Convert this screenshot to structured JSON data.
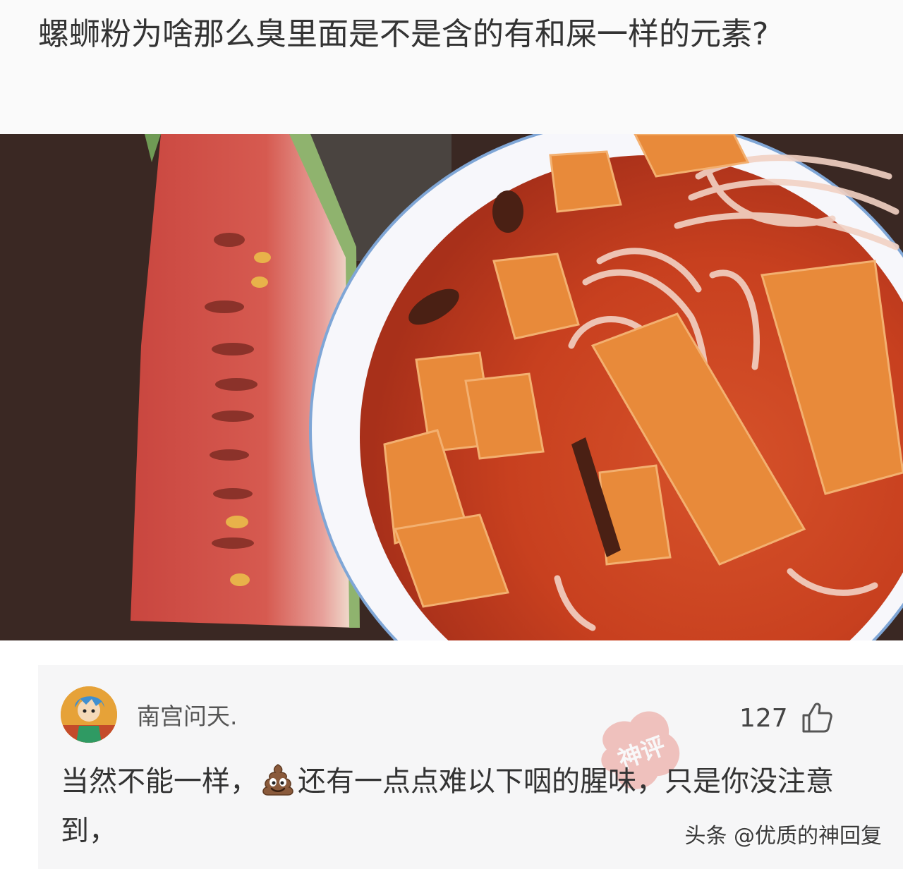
{
  "question": {
    "title": "螺蛳粉为啥那么臭里面是不是含的有和屎一样的元素?"
  },
  "photo": {
    "description_icons": [
      "watermelon-slice",
      "luosifen-bowl"
    ]
  },
  "comment": {
    "username": "南宫问天.",
    "like_count": "127",
    "text_before_emoji": "当然不能一样，",
    "emoji_icon": "poop-emoji-icon",
    "text_after_emoji": "还有一点点难以下咽的腥味，只是你没注意到，",
    "stamp_text": "神评"
  },
  "watermark": {
    "text": "头条 @优质的神回复"
  },
  "colors": {
    "accent_red": "#e03c2c",
    "text_dark": "#333333",
    "card_bg": "#f6f6f7"
  }
}
